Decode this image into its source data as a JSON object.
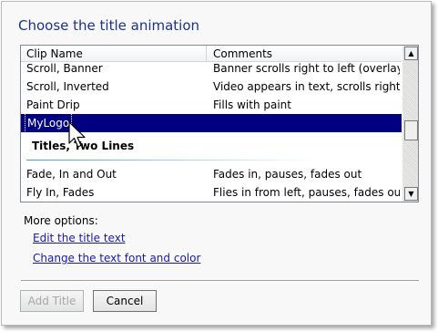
{
  "dialog": {
    "title": "Choose the title animation"
  },
  "list": {
    "columns": [
      "Clip Name",
      "Comments"
    ],
    "rows": [
      {
        "name": "Scroll, Banner",
        "comment": "Banner scrolls right to left (overlay)"
      },
      {
        "name": "Scroll, Inverted",
        "comment": "Video appears in text, scrolls right to ..."
      },
      {
        "name": "Paint Drip",
        "comment": "Fills with paint"
      },
      {
        "name": "MyLogo",
        "comment": "",
        "selected": true
      }
    ],
    "group_title": "Titles, Two Lines",
    "group_rows": [
      {
        "name": "Fade, In and Out",
        "comment": "Fades in, pauses, fades out"
      },
      {
        "name": "Fly In, Fades",
        "comment": "Flies in from left, pauses, fades out"
      }
    ]
  },
  "scrollbar": {
    "up_glyph": "▲",
    "down_glyph": "▼"
  },
  "options": {
    "label": "More options:",
    "links": [
      "Edit the title text",
      "Change the text font and color"
    ]
  },
  "buttons": {
    "add_title": "Add Title",
    "cancel": "Cancel"
  },
  "colors": {
    "title": "#1e3287",
    "selection": "#000080",
    "link": "#1a1aa6"
  }
}
